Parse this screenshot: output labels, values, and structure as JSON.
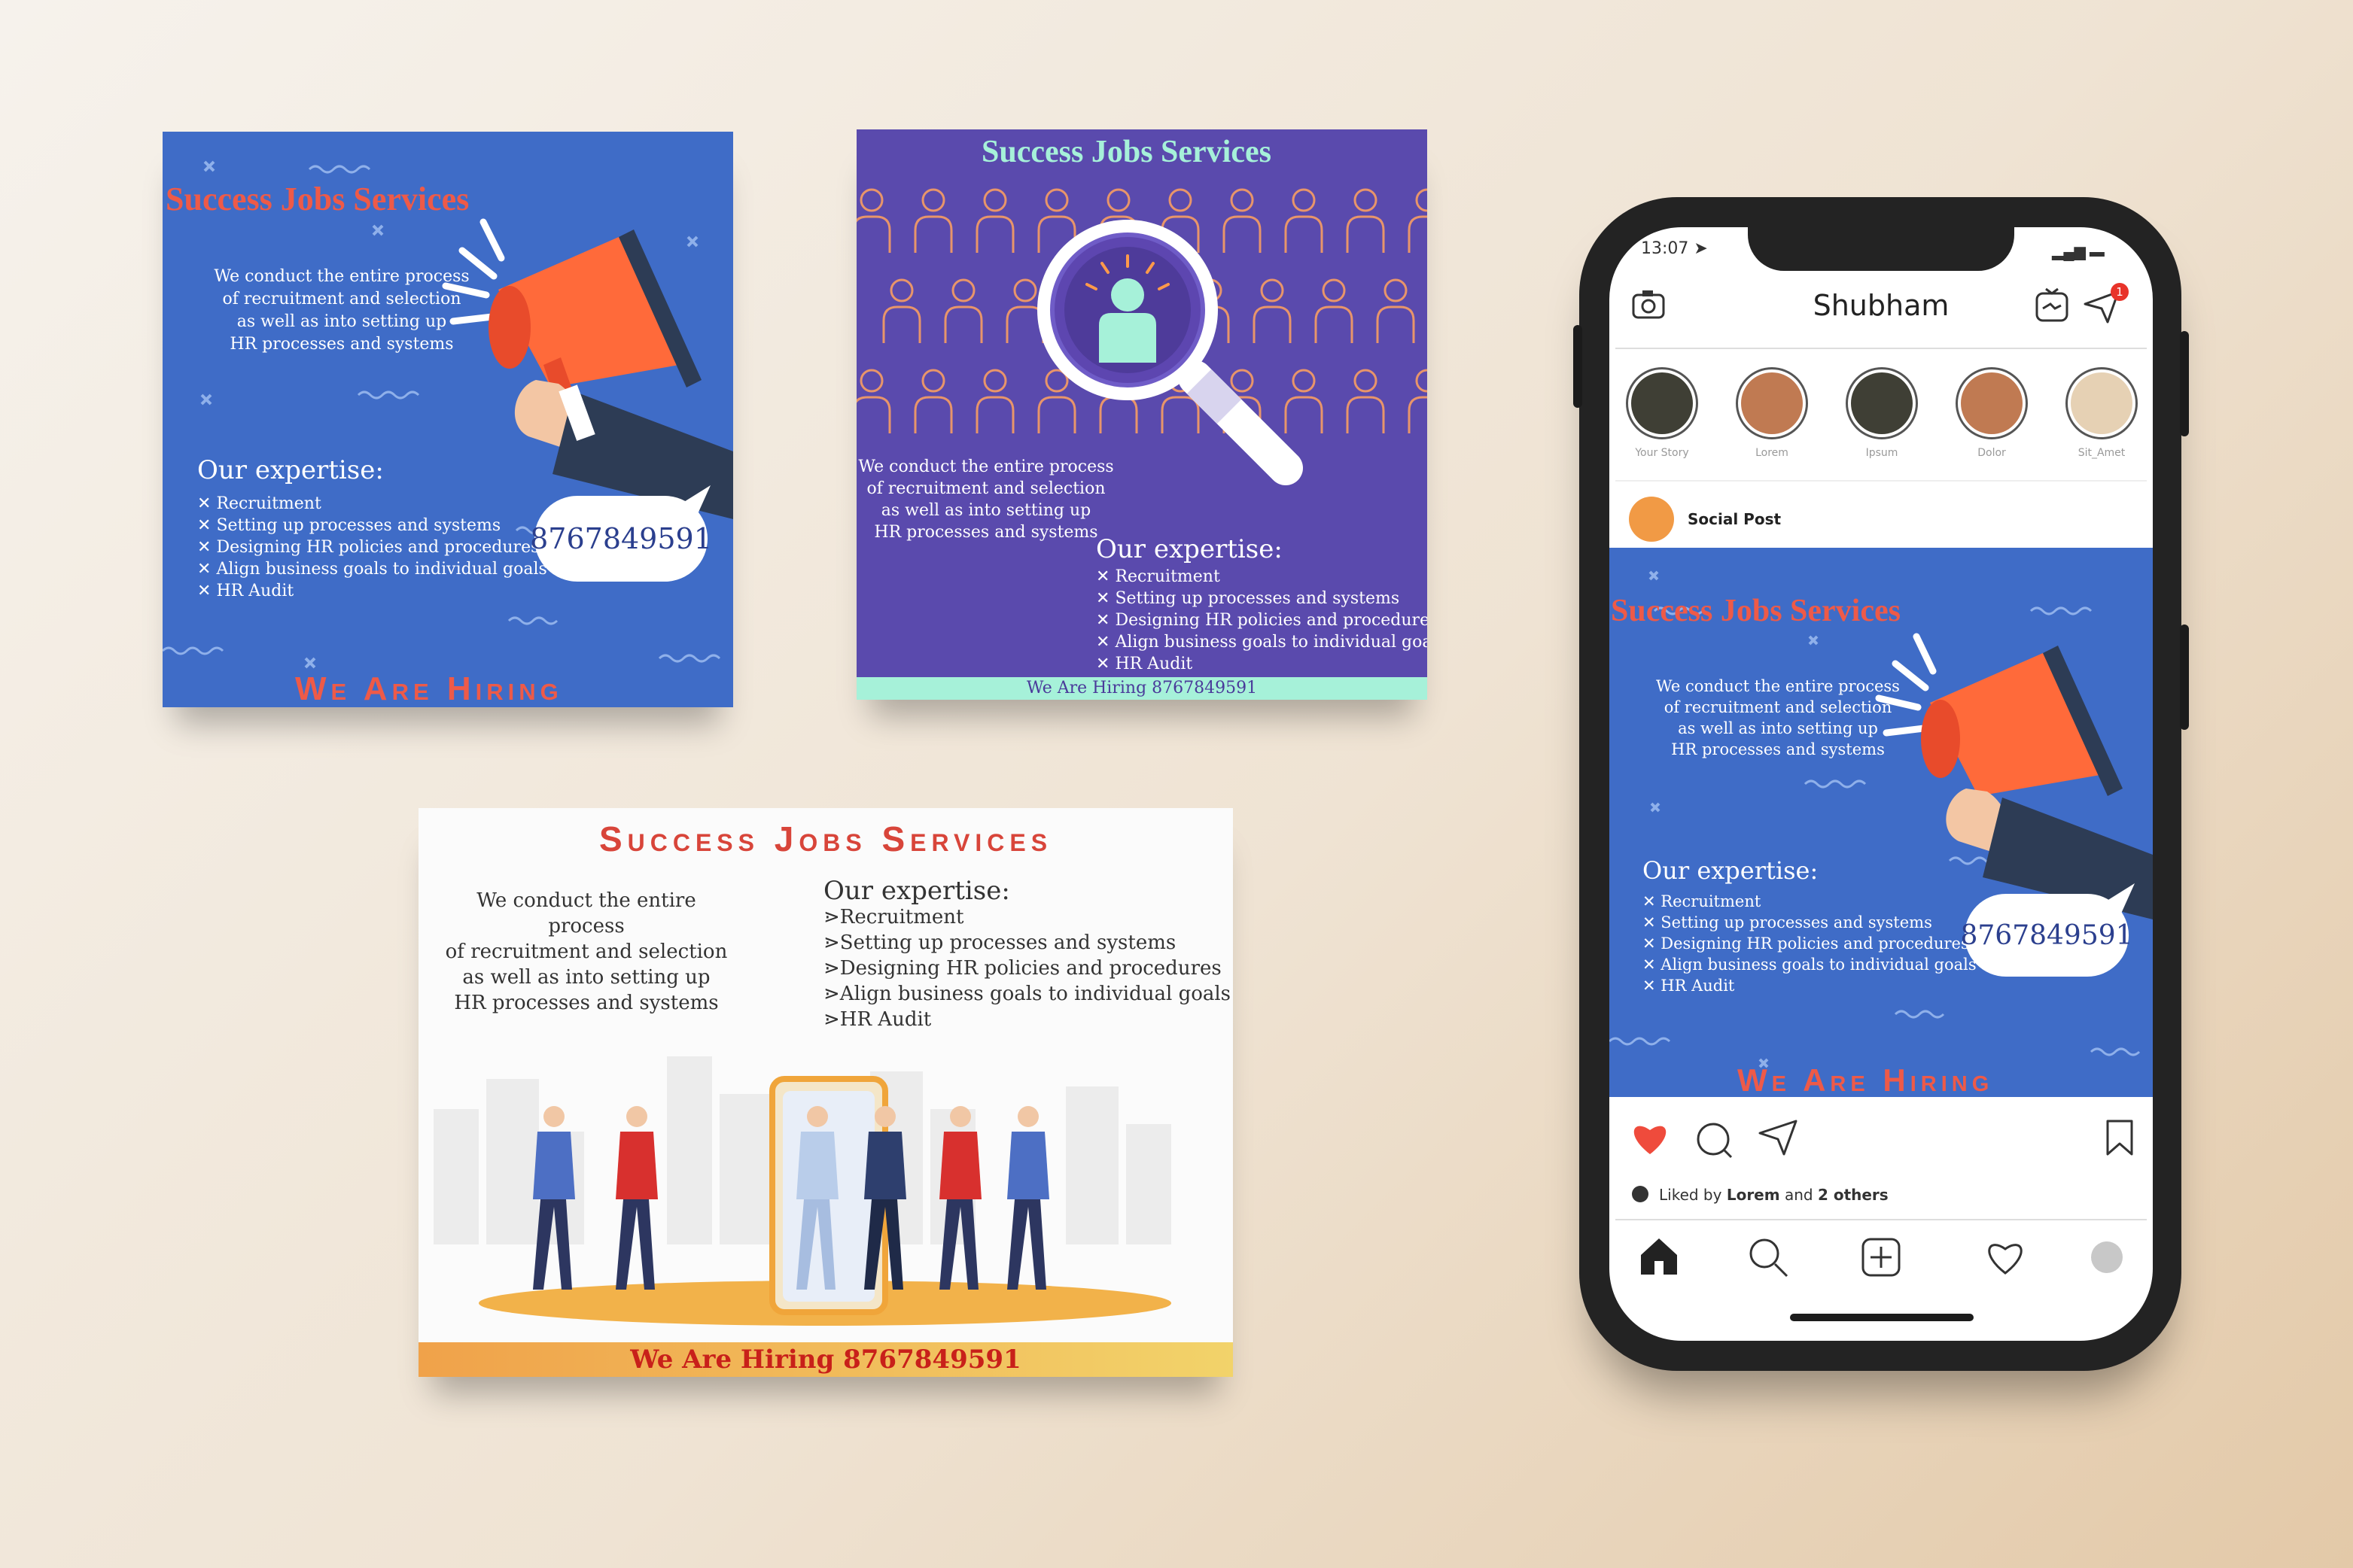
{
  "brand_title": "Success Jobs Services",
  "intro_lines": [
    "We conduct the entire process",
    "of recruitment and selection",
    "as well as into setting up",
    "HR processes and systems"
  ],
  "expertise_heading": "Our expertise:",
  "expertise_items": [
    "Recruitment",
    "Setting up processes and systems",
    "Designing HR policies and procedures",
    "Align business goals to individual goals",
    "HR Audit"
  ],
  "phone_number": "8767849591",
  "hiring_text": "We Are Hiring",
  "hiring_with_phone": "We Are Hiring 8767849591",
  "colors": {
    "blue": "#3f6cc7",
    "purple": "#5a4aad",
    "red": "#ee5a48",
    "mint": "#a6f1d9"
  },
  "phone_ui": {
    "status_time": "13:07",
    "username": "Shubham",
    "notification_count": "1",
    "stories": [
      {
        "label": "Your Story",
        "color": "#3f3f35"
      },
      {
        "label": "Lorem",
        "color": "#c07a52"
      },
      {
        "label": "Ipsum",
        "color": "#3f3f35"
      },
      {
        "label": "Dolor",
        "color": "#c07a52"
      },
      {
        "label": "Sit_Amet",
        "color": "#e6d1b4"
      }
    ],
    "post_account": "Social Post",
    "liked_by_prefix": "Liked by",
    "liked_by_user": "Lorem",
    "liked_by_and": "and",
    "liked_by_others": "2 others",
    "icons": [
      "camera-icon",
      "tv-icon",
      "send-icon",
      "heart-icon",
      "comment-icon",
      "share-icon",
      "bookmark-icon",
      "home-icon",
      "search-icon",
      "add-icon",
      "activity-icon",
      "profile-icon"
    ]
  }
}
